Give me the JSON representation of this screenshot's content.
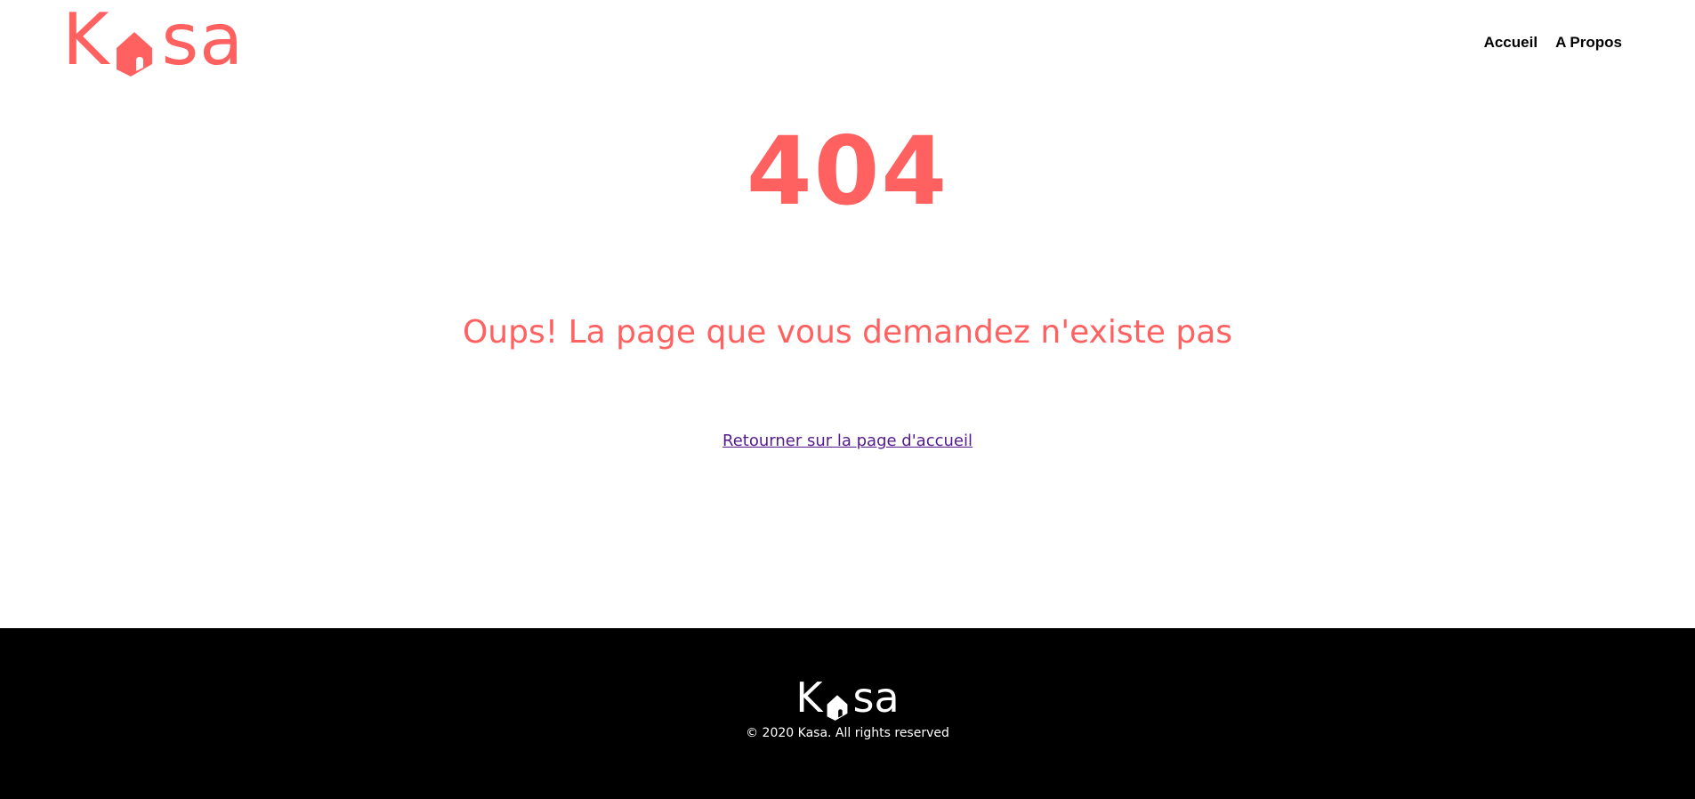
{
  "header": {
    "logo": {
      "first_letter": "K",
      "rest": "sa",
      "icon": "house-icon"
    },
    "nav": [
      {
        "label": "Accueil"
      },
      {
        "label": "A Propos"
      }
    ]
  },
  "main": {
    "error_code": "404",
    "message": "Oups! La page que vous demandez n'existe pas",
    "back_link": "Retourner sur la page d'accueil"
  },
  "footer": {
    "logo": {
      "first_letter": "K",
      "rest": "sa",
      "icon": "house-icon"
    },
    "copyright": "© 2020 Kasa. All rights reserved"
  },
  "colors": {
    "brand": "#FF6060",
    "footer_bg": "#000000",
    "link_visited": "#551A8B"
  }
}
